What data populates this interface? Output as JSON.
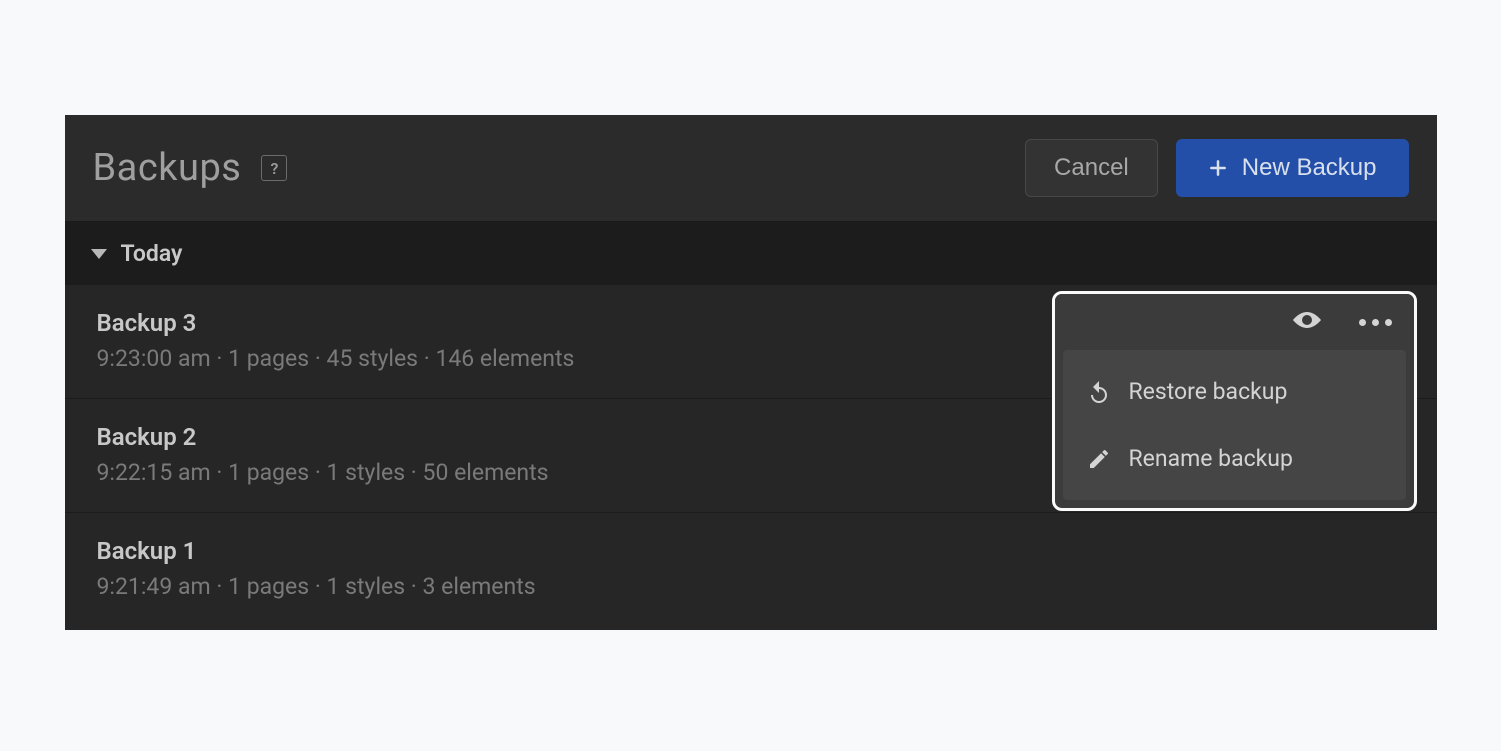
{
  "header": {
    "title": "Backups",
    "help_glyph": "?",
    "cancel_label": "Cancel",
    "new_backup_label": "New Backup"
  },
  "section": {
    "label": "Today"
  },
  "backups": [
    {
      "name": "Backup 3",
      "meta": "9:23:00 am · 1 pages · 45 styles · 146 elements"
    },
    {
      "name": "Backup 2",
      "meta": "9:22:15 am · 1 pages · 1 styles · 50 elements"
    },
    {
      "name": "Backup 1",
      "meta": "9:21:49 am · 1 pages · 1 styles · 3 elements"
    }
  ],
  "popover": {
    "restore_label": "Restore backup",
    "rename_label": "Rename backup"
  }
}
